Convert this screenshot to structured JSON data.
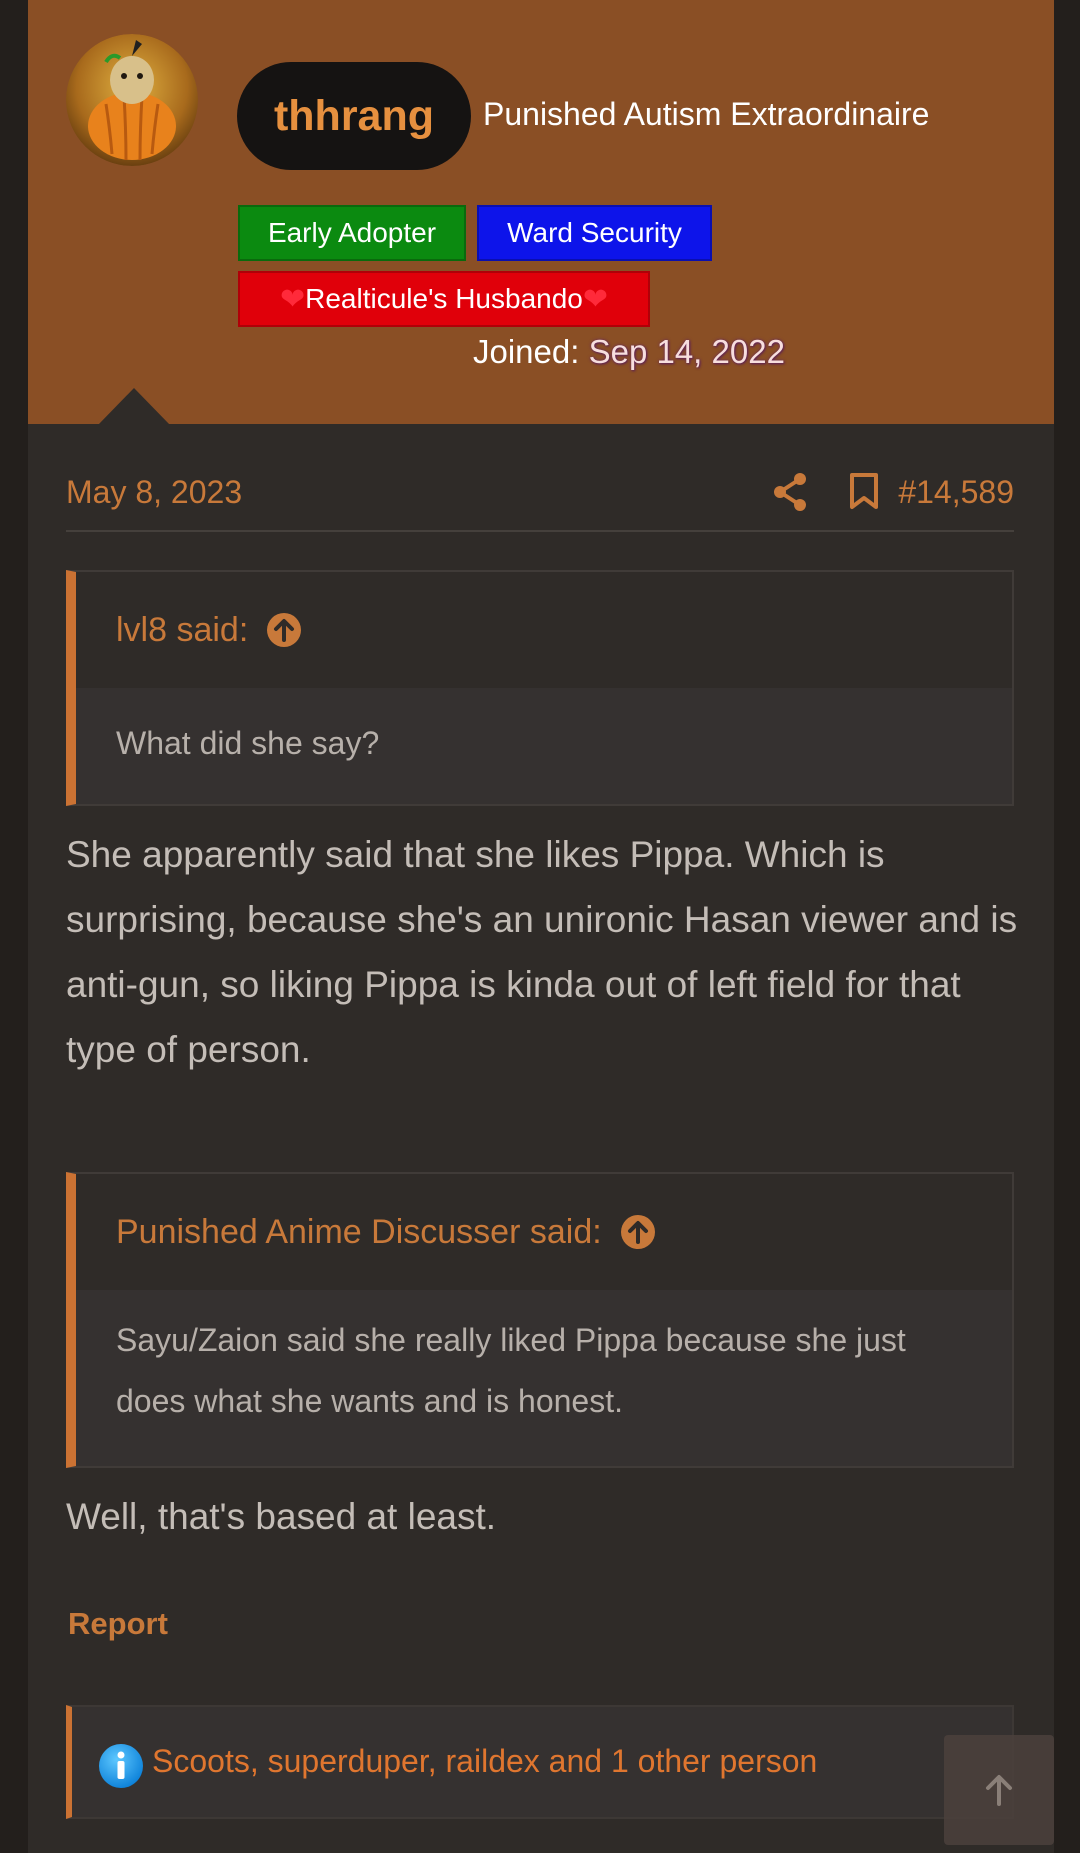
{
  "user": {
    "name": "thhrang",
    "title": "Punished Autism Extraordinaire",
    "banners": [
      "Early Adopter",
      "Ward Security",
      "Realticule's Husbando"
    ],
    "joined_label": "Joined:",
    "joined_date": "Sep 14, 2022"
  },
  "post": {
    "date": "May 8, 2023",
    "number": "#14,589",
    "quote1": {
      "author": "lvl8 said:",
      "text": "What did she say?"
    },
    "paragraph1": "She apparently said that she likes Pippa. Which is surprising, because she's an unironic Hasan viewer and is anti-gun, so liking Pippa is kinda out of left field for that type of person.",
    "quote2": {
      "author": "Punished Anime Discusser said:",
      "text": "Sayu/Zaion said she really liked Pippa because she just does what she wants and is honest."
    },
    "paragraph2": "Well, that's based at least.",
    "report_label": "Report",
    "reactions": "Scoots, superduper, raildex and 1 other person"
  },
  "colors": {
    "accent": "#c8793a",
    "header_bg": "#8a4f25",
    "post_bg": "#2f2b28"
  }
}
